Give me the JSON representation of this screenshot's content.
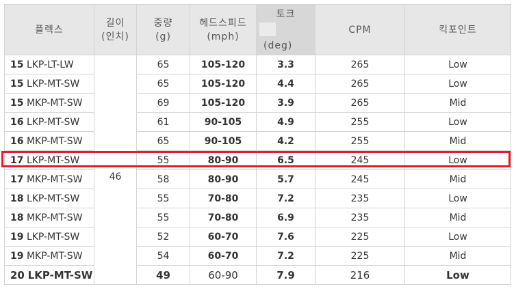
{
  "headers": {
    "flex": "플렉스",
    "length_line1": "길이",
    "length_line2": "(인치)",
    "weight_line1": "중량",
    "weight_line2": "(g)",
    "speed_line1": "헤드스피드",
    "speed_line2": "(mph)",
    "torque_line1": "토크",
    "torque_line2": "(deg)",
    "cpm": "CPM",
    "kick": "킥포인트"
  },
  "length_value": "46",
  "rows": [
    {
      "num": "15",
      "model": "LKP-LT-LW",
      "weight": "65",
      "speed": "105-120",
      "torque": "3.3",
      "cpm": "265",
      "kick": "Low"
    },
    {
      "num": "15",
      "model": "LKP-MT-SW",
      "weight": "65",
      "speed": "105-120",
      "torque": "4.4",
      "cpm": "265",
      "kick": "Low"
    },
    {
      "num": "15",
      "model": "MKP-MT-SW",
      "weight": "69",
      "speed": "105-120",
      "torque": "3.9",
      "cpm": "265",
      "kick": "Mid"
    },
    {
      "num": "16",
      "model": "LKP-MT-SW",
      "weight": "61",
      "speed": "90-105",
      "torque": "4.9",
      "cpm": "255",
      "kick": "Low"
    },
    {
      "num": "16",
      "model": "MKP-MT-SW",
      "weight": "65",
      "speed": "90-105",
      "torque": "4.2",
      "cpm": "255",
      "kick": "Mid"
    },
    {
      "num": "17",
      "model": "LKP-MT-SW",
      "weight": "55",
      "speed": "80-90",
      "torque": "6.5",
      "cpm": "245",
      "kick": "Low"
    },
    {
      "num": "17",
      "model": "MKP-MT-SW",
      "weight": "58",
      "speed": "80-90",
      "torque": "5.7",
      "cpm": "245",
      "kick": "Mid"
    },
    {
      "num": "18",
      "model": "LKP-MT-SW",
      "weight": "55",
      "speed": "70-80",
      "torque": "7.2",
      "cpm": "235",
      "kick": "Low"
    },
    {
      "num": "18",
      "model": "MKP-MT-SW",
      "weight": "55",
      "speed": "70-80",
      "torque": "6.9",
      "cpm": "235",
      "kick": "Mid"
    },
    {
      "num": "19",
      "model": "LKP-MT-SW",
      "weight": "52",
      "speed": "60-70",
      "torque": "7.6",
      "cpm": "225",
      "kick": "Low"
    },
    {
      "num": "19",
      "model": "MKP-MT-SW",
      "weight": "54",
      "speed": "60-70",
      "torque": "7.2",
      "cpm": "225",
      "kick": "Mid"
    },
    {
      "num": "20",
      "model": "LKP-MT-SW",
      "weight": "49",
      "speed": "60-90",
      "torque": "7.9",
      "cpm": "216",
      "kick": "Low"
    }
  ],
  "highlighted_row_index": 5,
  "colors": {
    "highlight": "#e8192c",
    "header_bg": "#e7e7e7",
    "border": "#d4d4d4"
  }
}
